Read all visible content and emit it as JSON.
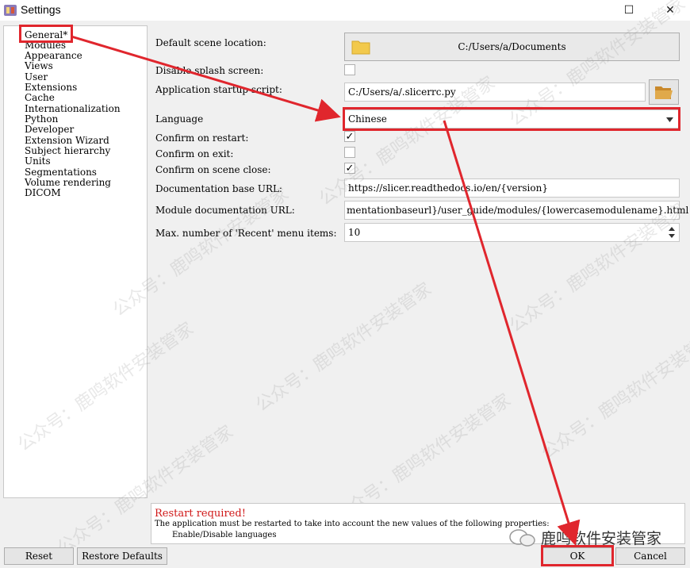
{
  "window": {
    "title": "Settings",
    "maximize_glyph": "☐",
    "close_glyph": "✕"
  },
  "nav": {
    "items": [
      "General*",
      "Modules",
      "Appearance",
      "Views",
      "User",
      "Extensions",
      "Cache",
      "Internationalization",
      "Python",
      "Developer",
      "Extension Wizard",
      "Subject hierarchy",
      "Units",
      "Segmentations",
      "Volume rendering",
      "DICOM"
    ],
    "selected_index": 0
  },
  "form": {
    "default_scene_location": {
      "label": "Default scene location:",
      "value": "C:/Users/a/Documents"
    },
    "disable_splash": {
      "label": "Disable splash screen:",
      "checked": false
    },
    "startup_script": {
      "label": "Application startup script:",
      "value": "C:/Users/a/.slicerrc.py"
    },
    "language": {
      "label": "Language",
      "value": "Chinese"
    },
    "confirm_restart": {
      "label": "Confirm on restart:",
      "checked": true
    },
    "confirm_exit": {
      "label": "Confirm on exit:",
      "checked": false
    },
    "confirm_scene_close": {
      "label": "Confirm on scene close:",
      "checked": true
    },
    "doc_base_url": {
      "label": "Documentation base URL:",
      "value": "https://slicer.readthedocs.io/en/{version}"
    },
    "module_doc_url": {
      "label": "Module documentation URL:",
      "value": "mentationbaseurl}/user_guide/modules/{lowercasemodulename}.html"
    },
    "max_recent": {
      "label": "Max. number of 'Recent' menu items:",
      "value": "10"
    }
  },
  "message": {
    "title": "Restart required!",
    "line1": "The application must be restarted to take into account the new values of the following properties:",
    "line2": "Enable/Disable languages"
  },
  "buttons": {
    "reset": "Reset",
    "restore_defaults": "Restore Defaults",
    "ok": "OK",
    "cancel": "Cancel"
  },
  "check_glyph": "✓",
  "watermark": {
    "text": "公众号：鹿鸣软件安装管家",
    "brand": "鹿鸣软件安装管家"
  },
  "colors": {
    "annotation": "#e0262d",
    "folder": "#f2c94c"
  }
}
